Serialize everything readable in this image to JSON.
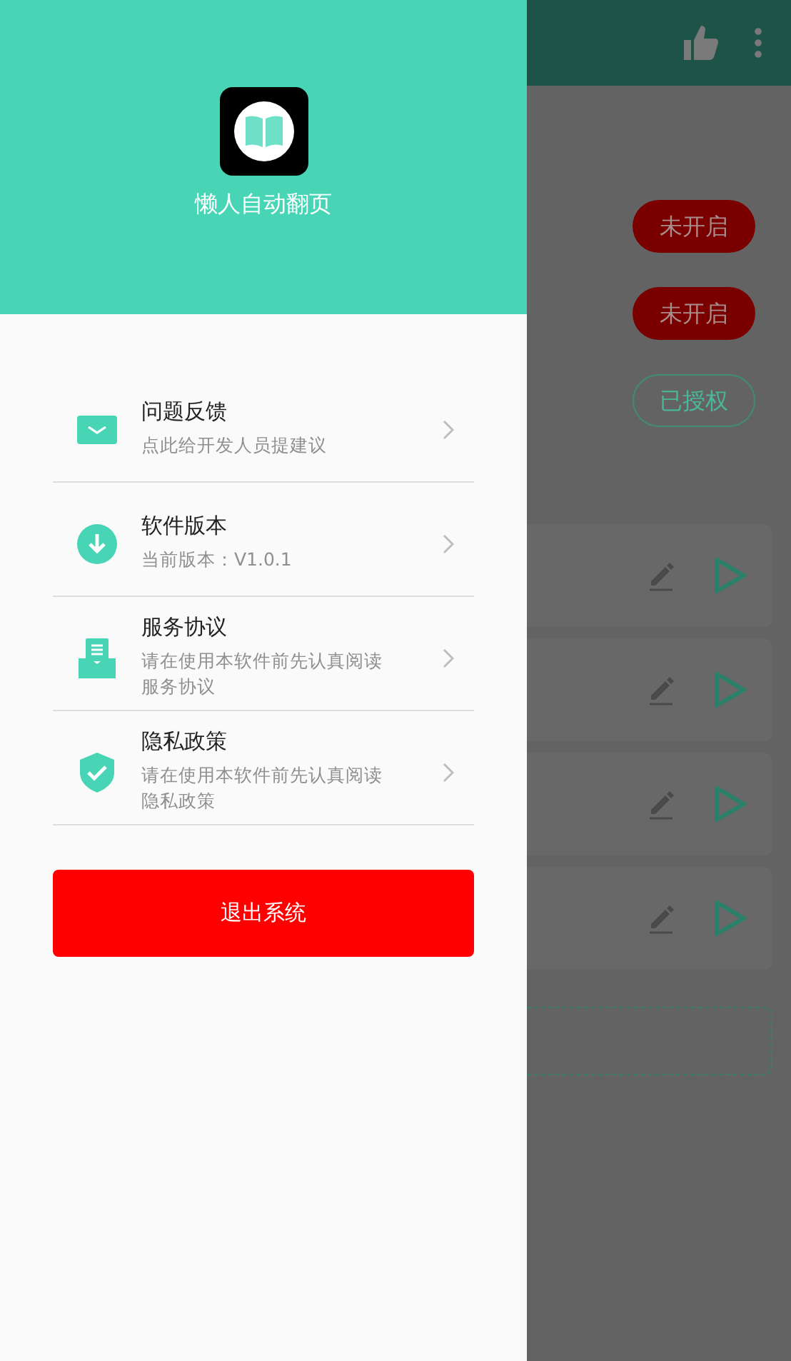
{
  "drawer": {
    "app_name": "懒人自动翻页",
    "menu_items": [
      {
        "kind": "mail",
        "title": "问题反馈",
        "subtitle": "点此给开发人员提建议"
      },
      {
        "kind": "download",
        "title": "软件版本",
        "subtitle": "当前版本：V1.0.1"
      },
      {
        "kind": "document",
        "title": "服务协议",
        "subtitle": "请在使用本软件前先认真阅读服务协议"
      },
      {
        "kind": "shield",
        "title": "隐私政策",
        "subtitle": "请在使用本软件前先认真阅读隐私政策"
      }
    ],
    "logout_button": "退出系统"
  },
  "background": {
    "status_chips": [
      {
        "label": "未开启",
        "kind": "off"
      },
      {
        "label": "未开启",
        "kind": "off"
      },
      {
        "label": "已授权",
        "kind": "granted"
      }
    ],
    "task_cards": [
      {
        "kind": "task"
      },
      {
        "kind": "task"
      },
      {
        "kind": "task"
      },
      {
        "kind": "task"
      }
    ]
  }
}
